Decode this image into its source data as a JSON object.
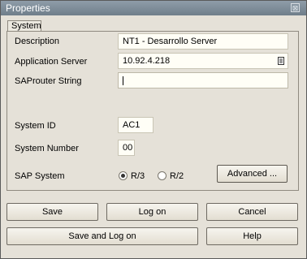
{
  "window": {
    "title": "Properties",
    "close_glyph": "⊠"
  },
  "tab": {
    "label": "System"
  },
  "fields": {
    "description": {
      "label": "Description",
      "value": "NT1 - Desarrollo Server"
    },
    "application_server": {
      "label": "Application Server",
      "value": "10.92.4.218",
      "icon": "value-help-icon"
    },
    "saprouter": {
      "label": "SAProuter String",
      "value": ""
    },
    "system_id": {
      "label": "System ID",
      "value": "AC1"
    },
    "system_number": {
      "label": "System Number",
      "value": "00"
    }
  },
  "sap_system": {
    "label": "SAP System",
    "options": [
      {
        "label": "R/3",
        "selected": true
      },
      {
        "label": "R/2",
        "selected": false
      }
    ],
    "advanced_label": "Advanced ..."
  },
  "buttons": {
    "save": "Save",
    "logon": "Log on",
    "cancel": "Cancel",
    "save_logon": "Save and Log on",
    "help": "Help"
  }
}
